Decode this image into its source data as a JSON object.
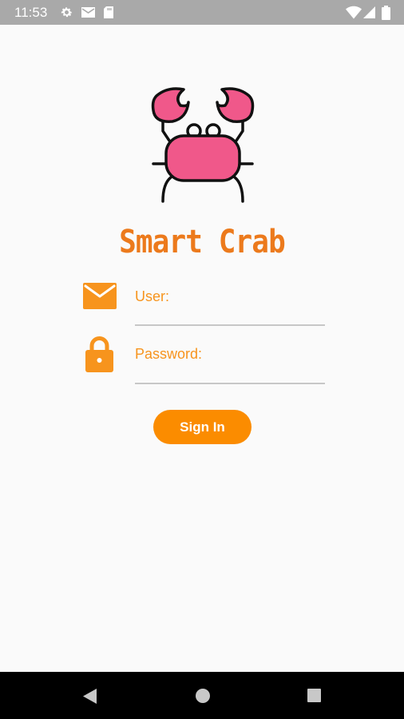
{
  "status_bar": {
    "time": "11:53",
    "icons": [
      "gear-icon",
      "mail-icon",
      "sd-card-icon",
      "wifi-icon",
      "signal-icon",
      "battery-icon"
    ]
  },
  "app": {
    "logo_icon": "crab-icon",
    "title": "Smart Crab",
    "title_color": "#ec7a1c",
    "accent_color": "#f7941d",
    "logo_color": "#f0588a"
  },
  "login_form": {
    "user_label": "User:",
    "user_value": "",
    "password_label": "Password:",
    "password_value": "",
    "sign_in_label": "Sign In",
    "button_color": "#fb8c00"
  },
  "nav_bar": {
    "buttons": [
      "back-icon",
      "home-icon",
      "recents-icon"
    ]
  }
}
